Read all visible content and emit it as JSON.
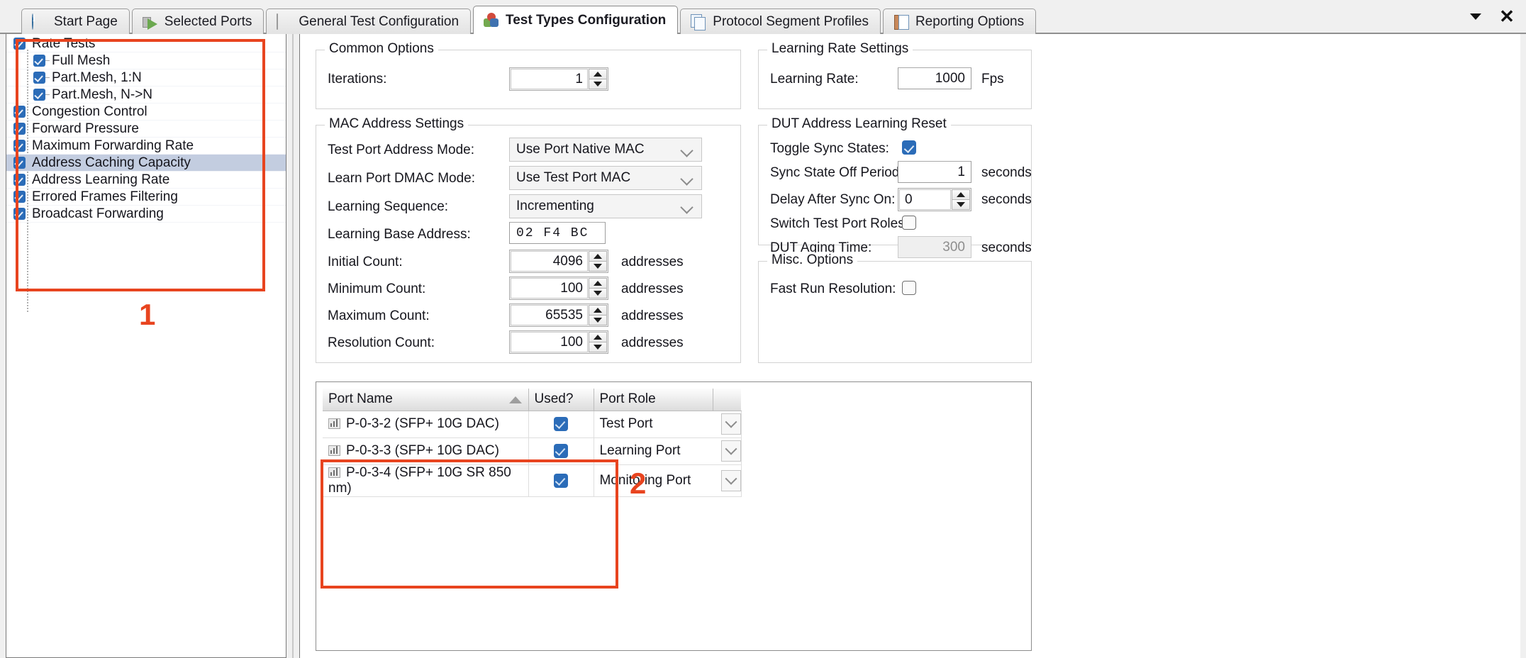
{
  "tabs": [
    {
      "label": "Start Page",
      "icon": "info-icon",
      "active": false
    },
    {
      "label": "Selected Ports",
      "icon": "ports-icon",
      "active": false
    },
    {
      "label": "General Test Configuration",
      "icon": "general-config-icon",
      "active": false
    },
    {
      "label": "Test Types Configuration",
      "icon": "test-types-icon",
      "active": true
    },
    {
      "label": "Protocol Segment Profiles",
      "icon": "protocol-profiles-icon",
      "active": false
    },
    {
      "label": "Reporting Options",
      "icon": "reporting-icon",
      "active": false
    }
  ],
  "window_controls": {
    "dropdown": "chevron-down-icon",
    "close": "close-icon",
    "close_glyph": "✕"
  },
  "tree": {
    "items": [
      {
        "label": "Rate Tests",
        "checked": true,
        "level": 0,
        "selected": false
      },
      {
        "label": "Full Mesh",
        "checked": true,
        "level": 1,
        "selected": false
      },
      {
        "label": "Part.Mesh, 1:N",
        "checked": true,
        "level": 1,
        "selected": false
      },
      {
        "label": "Part.Mesh, N->N",
        "checked": true,
        "level": 1,
        "selected": false
      },
      {
        "label": "Congestion Control",
        "checked": true,
        "level": 0,
        "selected": false
      },
      {
        "label": "Forward Pressure",
        "checked": true,
        "level": 0,
        "selected": false
      },
      {
        "label": "Maximum Forwarding Rate",
        "checked": true,
        "level": 0,
        "selected": false
      },
      {
        "label": "Address Caching Capacity",
        "checked": true,
        "level": 0,
        "selected": true
      },
      {
        "label": "Address Learning Rate",
        "checked": true,
        "level": 0,
        "selected": false
      },
      {
        "label": "Errored Frames Filtering",
        "checked": true,
        "level": 0,
        "selected": false
      },
      {
        "label": "Broadcast Forwarding",
        "checked": true,
        "level": 0,
        "selected": false
      }
    ]
  },
  "annotations": [
    {
      "number": "1"
    },
    {
      "number": "2"
    }
  ],
  "common_options": {
    "title": "Common Options",
    "iterations_label": "Iterations:",
    "iterations_value": "1"
  },
  "mac_settings": {
    "title": "MAC Address Settings",
    "test_port_address_mode_label": "Test Port Address Mode:",
    "test_port_address_mode_value": "Use Port Native MAC",
    "learn_port_dmac_mode_label": "Learn Port DMAC Mode:",
    "learn_port_dmac_mode_value": "Use Test Port MAC",
    "learning_sequence_label": "Learning Sequence:",
    "learning_sequence_value": "Incrementing",
    "learning_base_address_label": "Learning Base Address:",
    "learning_base_address_value": "02  F4  BC",
    "initial_count_label": "Initial Count:",
    "initial_count_value": "4096",
    "initial_count_unit": "addresses",
    "minimum_count_label": "Minimum Count:",
    "minimum_count_value": "100",
    "minimum_count_unit": "addresses",
    "maximum_count_label": "Maximum Count:",
    "maximum_count_value": "65535",
    "maximum_count_unit": "addresses",
    "resolution_count_label": "Resolution Count:",
    "resolution_count_value": "100",
    "resolution_count_unit": "addresses"
  },
  "learning_rate_settings": {
    "title": "Learning Rate Settings",
    "learning_rate_label": "Learning Rate:",
    "learning_rate_value": "1000",
    "learning_rate_unit": "Fps"
  },
  "dut_reset": {
    "title": "DUT Address Learning Reset",
    "toggle_sync_states_label": "Toggle Sync States:",
    "toggle_sync_states_checked": true,
    "sync_state_off_period_label": "Sync State Off Period:",
    "sync_state_off_period_value": "1",
    "sync_state_off_period_unit": "seconds",
    "delay_after_sync_on_label": "Delay After Sync On:",
    "delay_after_sync_on_value": "0",
    "delay_after_sync_on_unit": "seconds",
    "switch_test_port_roles_label": "Switch Test Port Roles:",
    "switch_test_port_roles_checked": false,
    "dut_aging_time_label": "DUT Aging Time:",
    "dut_aging_time_value": "300",
    "dut_aging_time_unit": "seconds",
    "dut_aging_time_disabled": true
  },
  "misc_options": {
    "title": "Misc. Options",
    "fast_run_resolution_label": "Fast Run Resolution:",
    "fast_run_resolution_checked": false
  },
  "port_table": {
    "columns": [
      "Port Name",
      "Used?",
      "Port Role"
    ],
    "sort_column": "Port Name",
    "sort_direction": "ascending",
    "rows": [
      {
        "name": "P-0-3-2 (SFP+ 10G DAC)",
        "used": true,
        "role": "Test Port"
      },
      {
        "name": "P-0-3-3 (SFP+ 10G DAC)",
        "used": true,
        "role": "Learning Port"
      },
      {
        "name": "P-0-3-4 (SFP+ 10G SR 850 nm)",
        "used": true,
        "role": "Monitoring Port"
      }
    ]
  },
  "colors": {
    "accent_blue": "#2b6cb8",
    "annotation_red": "#e8441f",
    "selection": "#c3cde0",
    "window_bg": "#f0f0f0"
  }
}
